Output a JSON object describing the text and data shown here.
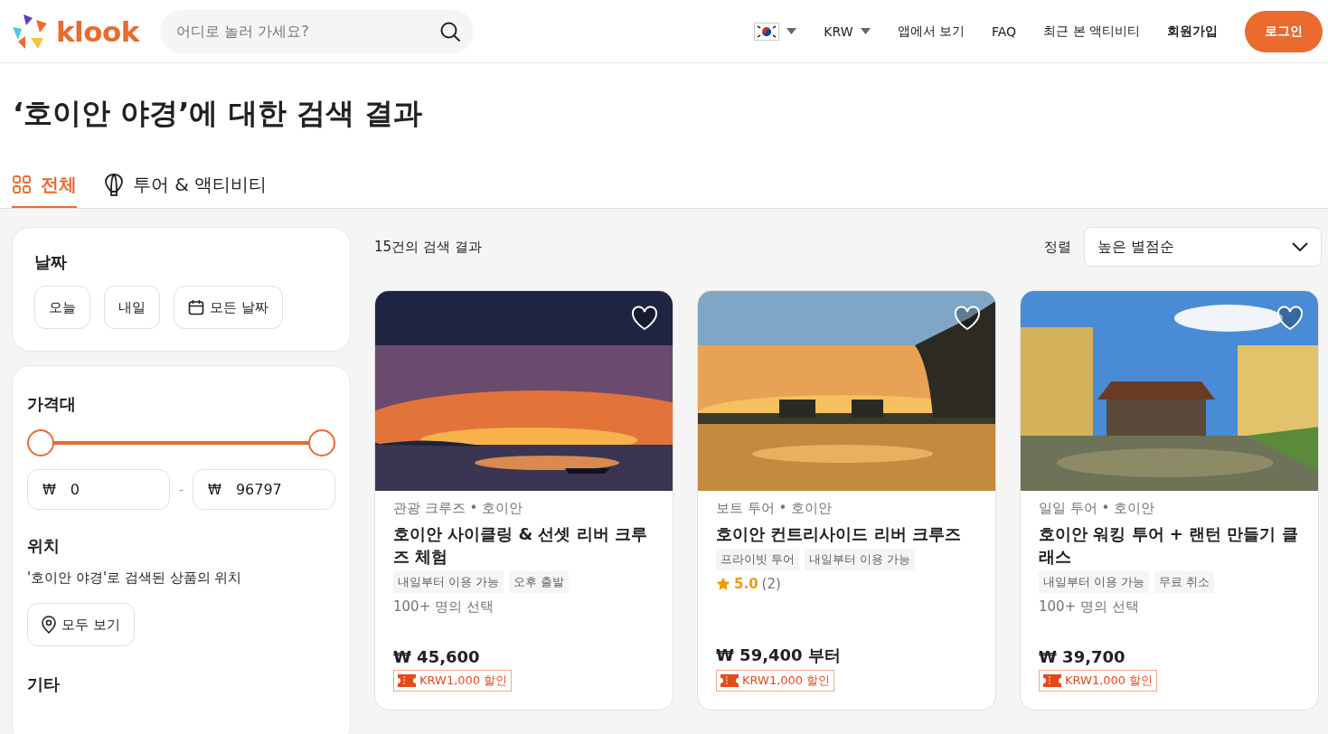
{
  "header": {
    "logo": "klook",
    "search": {
      "placeholder": "어디로 놀러 가세요?"
    },
    "nav": [
      {
        "kind": "flag"
      },
      {
        "kind": "dropdown",
        "label": "KRW"
      },
      {
        "kind": "link",
        "label": "앱에서 보기"
      },
      {
        "kind": "link",
        "label": "FAQ"
      },
      {
        "kind": "link",
        "label": "최근 본 액티비티"
      },
      {
        "kind": "strong",
        "label": "회원가입"
      },
      {
        "kind": "button",
        "label": "로그인"
      }
    ]
  },
  "page_title": "‘호이안 야경’에 대한 검색 결과",
  "tabs": [
    {
      "label": "전체",
      "selected": true
    },
    {
      "label": "투어 & 액티비티",
      "selected": false
    }
  ],
  "filters": {
    "date": {
      "title": "날짜",
      "options": [
        {
          "label": "오늘",
          "kind": "plain"
        },
        {
          "label": "내일",
          "kind": "plain"
        },
        {
          "label": "모든 날짜",
          "kind": "calendar"
        }
      ]
    },
    "price": {
      "title": "가격대",
      "level": 1,
      "min": {
        "currency": "₩",
        "value": "0"
      },
      "separator": "-",
      "max": {
        "currency": "₩",
        "value": "96797"
      }
    },
    "location": {
      "title": "위치",
      "description": "'호이안 야경'로 검색된 상품의 위치",
      "button": "모두 보기"
    },
    "other": {
      "title": "기타"
    }
  },
  "results": {
    "count": "15건의 검색 결과",
    "sort": {
      "label": "정렬",
      "value": "높은 별점순"
    },
    "cards": [
      {
        "category": "관광 크루즈 • 호이안",
        "title": "호이안 사이클링 & 선셋 리버 크루즈 체험",
        "tags": [
          "내일부터 이용 가능",
          "오후 출발"
        ],
        "popularity": "100+ 명의 선택",
        "price": "₩ 45,600",
        "promo": "KRW1,000 할인"
      },
      {
        "category": "보트 투어 • 호이안",
        "title": "호이안 컨트리사이드 리버 크루즈",
        "tags": [
          "프라이빗 투어",
          "내일부터 이용 가능"
        ],
        "rating": "5.0",
        "reviews": "(2)",
        "price": "₩ 59,400 부터",
        "promo": "KRW1,000 할인"
      },
      {
        "category": "일일 투어 • 호이안",
        "title": "호이안 워킹 투어 + 랜턴 만들기 클래스",
        "tags": [
          "내일부터 이용 가능",
          "무료 취소"
        ],
        "popularity": "100+ 명의 선택",
        "price": "₩ 39,700",
        "promo": "KRW1,000 할인"
      }
    ]
  }
}
